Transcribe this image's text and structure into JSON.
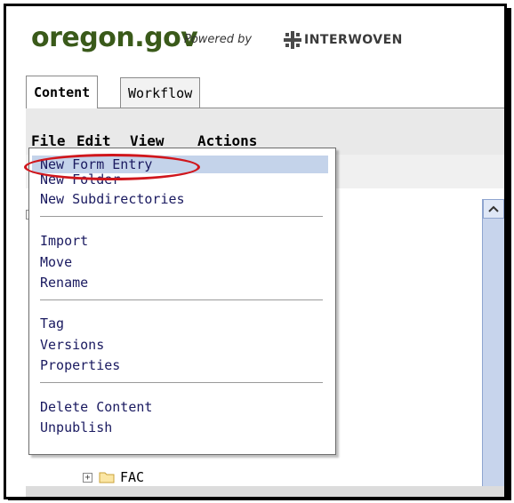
{
  "brand": {
    "name": "oregon.gov",
    "powered_by": "Powered by",
    "vendor": "INTERWOVEN"
  },
  "tabs": [
    {
      "label": "Content",
      "active": true
    },
    {
      "label": "Workflow",
      "active": false
    }
  ],
  "menubar": {
    "items": [
      "File",
      "Edit",
      "View",
      "Actions"
    ]
  },
  "dropdown": {
    "groups": [
      [
        "New Form Entry",
        "New Folder",
        "New Subdirectories"
      ],
      [
        "Import",
        "Move",
        "Rename"
      ],
      [
        "Tag",
        "Versions",
        "Properties"
      ],
      [
        "Delete Content",
        "Unpublish"
      ]
    ],
    "highlighted": "New Form Entry"
  },
  "tree": {
    "visible_folder": "FAC"
  },
  "colors": {
    "brand": "#3a5a1a",
    "highlight": "#c4d3ea",
    "annotation": "#d0161c",
    "scrollbar": "#c7d4ec"
  }
}
